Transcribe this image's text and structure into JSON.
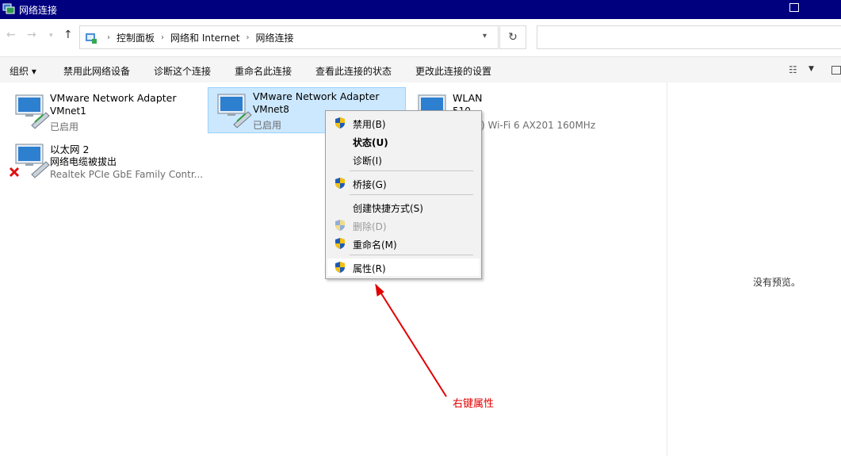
{
  "window": {
    "title": "网络连接"
  },
  "address": {
    "breadcrumbs": [
      "控制面板",
      "网络和 Internet",
      "网络连接"
    ]
  },
  "toolbar": {
    "organize": "组织 ▾",
    "disable": "禁用此网络设备",
    "diagnose": "诊断这个连接",
    "rename": "重命名此连接",
    "status": "查看此连接的状态",
    "settings": "更改此连接的设置"
  },
  "connections": [
    {
      "name": "VMware Network Adapter",
      "line2": "VMnet1",
      "line3": "已启用",
      "selected": false,
      "error": false
    },
    {
      "name": "VMware Network Adapter",
      "line2": "VMnet8",
      "line3": "已启用",
      "selected": true,
      "error": false
    },
    {
      "name": "WLAN",
      "line2": "510",
      "line3": ") Wi-Fi 6 AX201 160MHz",
      "selected": false,
      "error": false
    },
    {
      "name": "以太网 2",
      "line2": "网络电缆被拔出",
      "line3": "Realtek PCIe GbE Family Contr...",
      "selected": false,
      "error": true
    }
  ],
  "context_menu": {
    "items": [
      {
        "label": "禁用(B)",
        "shield": true
      },
      {
        "label": "状态(U)",
        "shield": false,
        "bold": true
      },
      {
        "label": "诊断(I)",
        "shield": false
      },
      {
        "label": "桥接(G)",
        "shield": true
      },
      {
        "label": "创建快捷方式(S)",
        "shield": false
      },
      {
        "label": "删除(D)",
        "shield": true,
        "disabled": true
      },
      {
        "label": "重命名(M)",
        "shield": true
      },
      {
        "label": "属性(R)",
        "shield": true,
        "highlighted": true
      }
    ]
  },
  "preview": {
    "message": "没有预览。"
  },
  "annotation": {
    "text": "右键属性",
    "color": "#e00000"
  }
}
